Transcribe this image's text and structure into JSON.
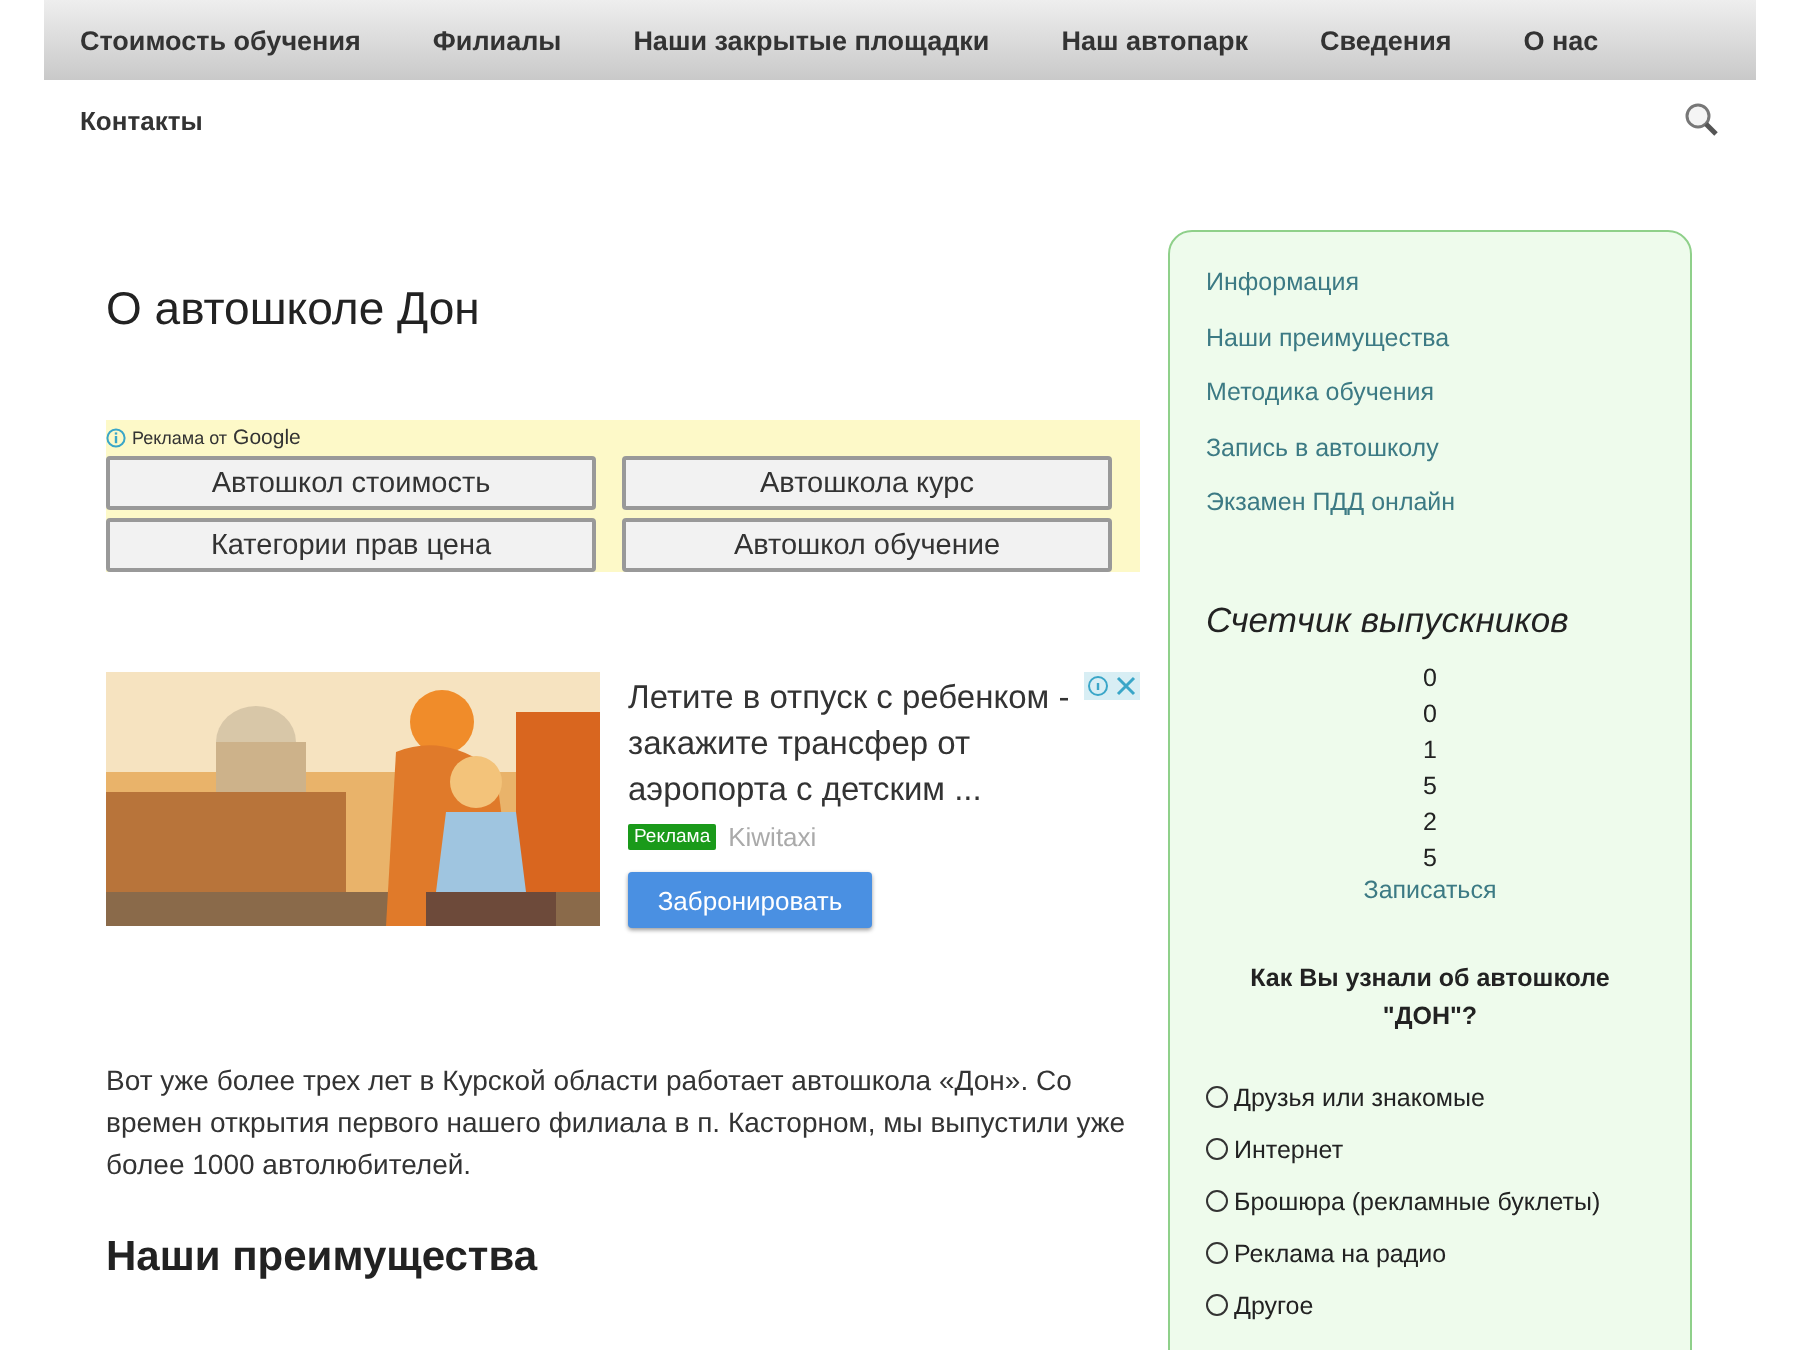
{
  "nav": {
    "items": [
      "Стоимость обучения",
      "Филиалы",
      "Наши закрытые площадки",
      "Наш автопарк",
      "Сведения",
      "О нас",
      "Контакты"
    ]
  },
  "main": {
    "title": "О автошколе Дон",
    "ad_links": {
      "label": "Реклама от",
      "brand": "Google",
      "links": [
        "Автошкол стоимость",
        "Автошкола курс",
        "Категории прав цена",
        "Автошкол обучение"
      ]
    },
    "ad_banner": {
      "headline": "Летите в отпуск с ребенком - закажите трансфер от аэропорта с детским ...",
      "badge": "Реклама",
      "advertiser": "Kiwitaxi",
      "button": "Забронировать"
    },
    "paragraph": "Вот уже более трех лет в Курской области работает автошкола «Дон». Со времен открытия первого нашего филиала в п. Касторном, мы выпустили уже более 1000 автолюбителей.",
    "heading": "Наши преимущества"
  },
  "sidebar": {
    "links": [
      "Информация",
      "Наши преимущества",
      "Методика обучения",
      "Запись в автошколу",
      "Экзамен ПДД онлайн"
    ],
    "counter": {
      "title": "Счетчик выпускников",
      "digits": [
        "0",
        "0",
        "1",
        "5",
        "2",
        "5"
      ],
      "link": "Записаться"
    },
    "poll": {
      "question": "Как Вы узнали об автошколе \"ДОН\"?",
      "options": [
        {
          "label": "Друзья или знакомые",
          "selected": false
        },
        {
          "label": "Интернет",
          "selected": false
        },
        {
          "label": "Брошюра (рекламные буклеты)",
          "selected": false
        },
        {
          "label": "Реклама на радио",
          "selected": false
        },
        {
          "label": "Другое",
          "selected": false
        }
      ]
    }
  }
}
